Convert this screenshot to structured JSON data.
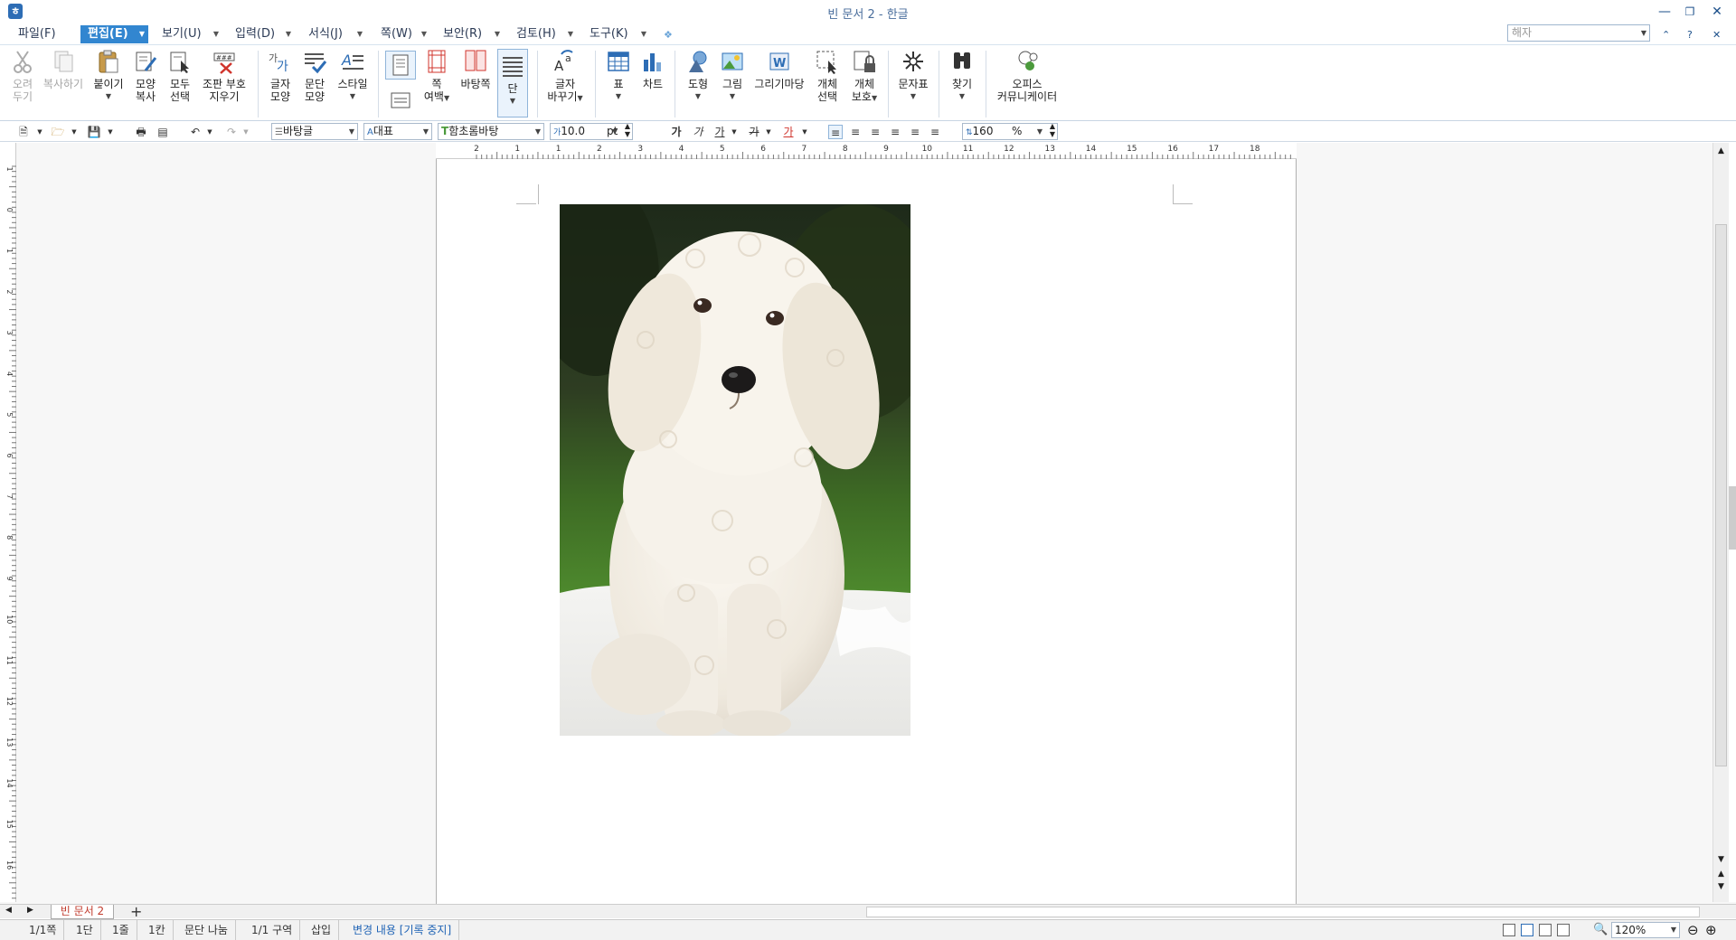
{
  "window": {
    "title": "빈 문서 2 - 한글"
  },
  "menubar": {
    "items": [
      {
        "label": "파일(F)"
      },
      {
        "label": "편집(E)",
        "active": true
      },
      {
        "label": "보기(U)"
      },
      {
        "label": "입력(D)"
      },
      {
        "label": "서식(J)"
      },
      {
        "label": "쪽(W)"
      },
      {
        "label": "보안(R)"
      },
      {
        "label": "검토(H)"
      },
      {
        "label": "도구(K)"
      }
    ],
    "search_placeholder": "해자"
  },
  "ribbon": {
    "cut": {
      "label1": "오려",
      "label2": "두기"
    },
    "copy": {
      "label": "복사하기"
    },
    "paste": {
      "label": "붙이기"
    },
    "format_copy": {
      "label1": "모양",
      "label2": "복사"
    },
    "select_all": {
      "label1": "모두",
      "label2": "선택"
    },
    "clear_marks": {
      "label1": "조판 부호",
      "label2": "지우기"
    },
    "char_shape": {
      "label1": "글자",
      "label2": "모양"
    },
    "para_shape": {
      "label1": "문단",
      "label2": "모양"
    },
    "style": {
      "label": "스타일"
    },
    "page_margin": {
      "label1": "쪽",
      "label2": "여백"
    },
    "background": {
      "label": "바탕쪽"
    },
    "columns": {
      "label": "단"
    },
    "replace": {
      "label1": "글자",
      "label2": "바꾸기"
    },
    "table": {
      "label": "표"
    },
    "chart": {
      "label": "차트"
    },
    "shape": {
      "label": "도형"
    },
    "picture": {
      "label": "그림"
    },
    "gallery": {
      "label": "그리기마당"
    },
    "obj_select": {
      "label1": "개체",
      "label2": "선택"
    },
    "obj_protect": {
      "label1": "개체",
      "label2": "보호"
    },
    "symbols": {
      "label": "문자표"
    },
    "find": {
      "label": "찾기"
    },
    "office": {
      "label1": "오피스",
      "label2": "커뮤니케이터"
    }
  },
  "format": {
    "style": "바탕글",
    "lang": "대표",
    "font": "함초롬바탕",
    "size": "10.0",
    "unit": "pt",
    "bold": "가",
    "italic": "가",
    "underline": "가",
    "strike": "가",
    "color": "가",
    "line_spacing": "160",
    "line_unit": "%"
  },
  "ruler": {
    "h_ticks": [
      "2",
      "1",
      "1",
      "2",
      "3",
      "4",
      "5",
      "6",
      "7",
      "8",
      "9",
      "10",
      "11",
      "12",
      "13",
      "14",
      "15",
      "16",
      "17",
      "18"
    ],
    "v_ticks": [
      "1",
      "0",
      "1",
      "2",
      "3",
      "4",
      "5",
      "6",
      "7",
      "8",
      "9",
      "10",
      "11",
      "12",
      "13",
      "14",
      "15",
      "16"
    ]
  },
  "document": {
    "tab_label": "빈 문서 2",
    "image_subject": "white-puppy-photo"
  },
  "statusbar": {
    "page": "1/1쪽",
    "column": "1단",
    "line": "1줄",
    "col": "1칸",
    "para": "문단 나눔",
    "section": "1/1 구역",
    "mode": "삽입",
    "track": "변경 내용 [기록 중지]",
    "zoom": "120%"
  }
}
